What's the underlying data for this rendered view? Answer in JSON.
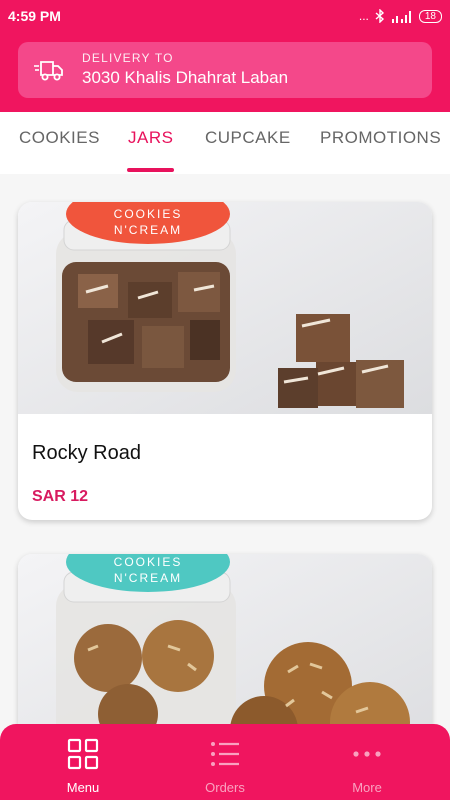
{
  "status_bar": {
    "time": "4:59 PM",
    "signal_text": "...",
    "battery": "18"
  },
  "delivery": {
    "label": "DELIVERY TO",
    "address": "3030 Khalis Dhahrat Laban"
  },
  "tabs": [
    {
      "label": "COOKIES",
      "active": false
    },
    {
      "label": "JARS",
      "active": true
    },
    {
      "label": "CUPCAKE",
      "active": false
    },
    {
      "label": "PROMOTIONS",
      "active": false
    }
  ],
  "products": [
    {
      "name": "Rocky Road",
      "price": "SAR 12",
      "jar_lid_text": [
        "COOKIES",
        "N'CREAM"
      ],
      "lid_color": "#f0553c"
    },
    {
      "name": "",
      "price": "",
      "jar_lid_text": [
        "COOKIES",
        "N'CREAM"
      ],
      "lid_color": "#4fc8c2"
    }
  ],
  "bottom_nav": [
    {
      "label": "Menu",
      "icon": "grid-icon",
      "active": true
    },
    {
      "label": "Orders",
      "icon": "list-icon",
      "active": false
    },
    {
      "label": "More",
      "icon": "more-icon",
      "active": false
    }
  ],
  "colors": {
    "brand": "#f0155f",
    "accent_text": "#e8125c",
    "price": "#d81b60"
  }
}
